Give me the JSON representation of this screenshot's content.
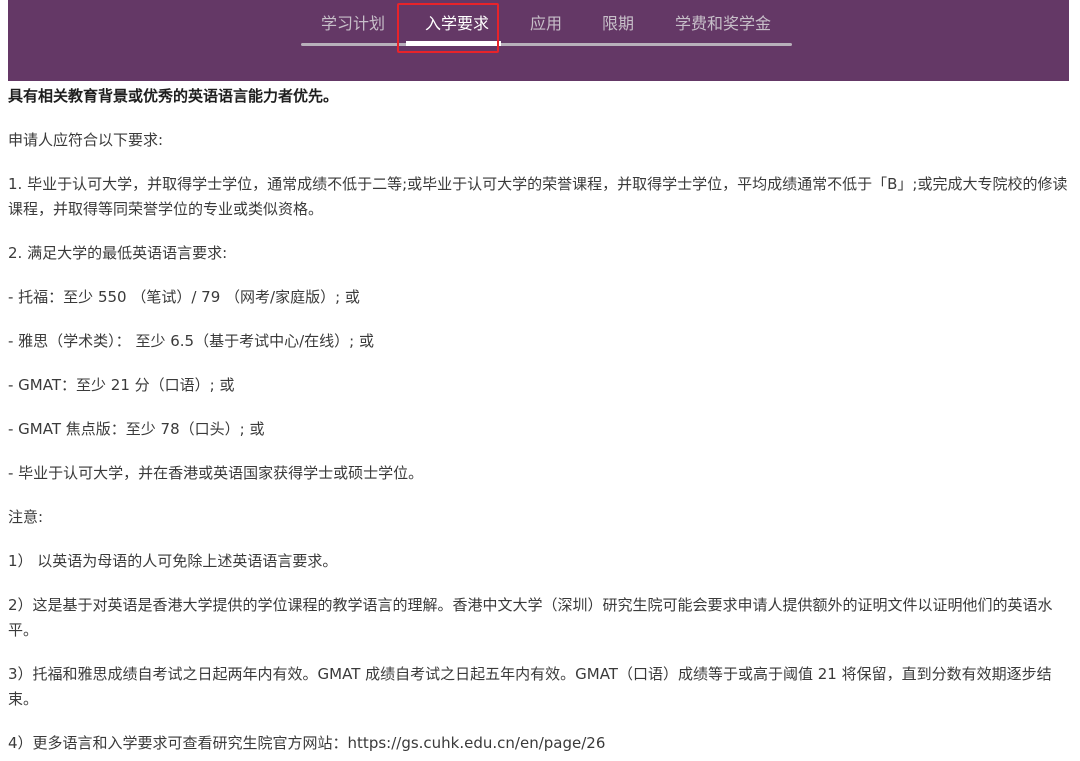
{
  "tabs": [
    {
      "label": "学习计划"
    },
    {
      "label": "入学要求"
    },
    {
      "label": "应用"
    },
    {
      "label": "限期"
    },
    {
      "label": "学费和奖学金"
    }
  ],
  "active_tab": "入学要求",
  "colors": {
    "header_bg": "#643866",
    "highlight": "#e8232a"
  },
  "content": {
    "lead": "具有相关教育背景或优秀的英语语言能力者优先。",
    "intro": "申请人应符合以下要求:",
    "req1": "1. 毕业于认可大学，并取得学士学位，通常成绩不低于二等;或毕业于认可大学的荣誉课程，并取得学士学位，平均成绩通常不低于「B」;或完成大专院校的修读课程，并取得等同荣誉学位的专业或类似资格。",
    "req2": "2. 满足大学的最低英语语言要求:",
    "toefl": "- 托福：至少 550 （笔试）/ 79 （网考/家庭版）; 或",
    "ielts": "- 雅思（学术类）： 至少 6.5（基于考试中心/在线）; 或",
    "gmat": "- GMAT：至少 21 分（口语）; 或",
    "gmat_focus": "- GMAT 焦点版：至少 78（口头）; 或",
    "degree": "- 毕业于认可大学，并在香港或英语国家获得学士或硕士学位。",
    "notes_title": "注意:",
    "note1": "1） 以英语为母语的人可免除上述英语语言要求。",
    "note2": "2）这是基于对英语是香港大学提供的学位课程的教学语言的理解。香港中文大学（深圳）研究生院可能会要求申请人提供额外的证明文件以证明他们的英语水平。",
    "note3": "3）托福和雅思成绩自考试之日起两年内有效。GMAT 成绩自考试之日起五年内有效。GMAT（口语）成绩等于或高于阈值 21 将保留，直到分数有效期逐步结束。",
    "note4": "4）更多语言和入学要求可查看研究生院官方网站：https://gs.cuhk.edu.cn/en/page/26"
  }
}
